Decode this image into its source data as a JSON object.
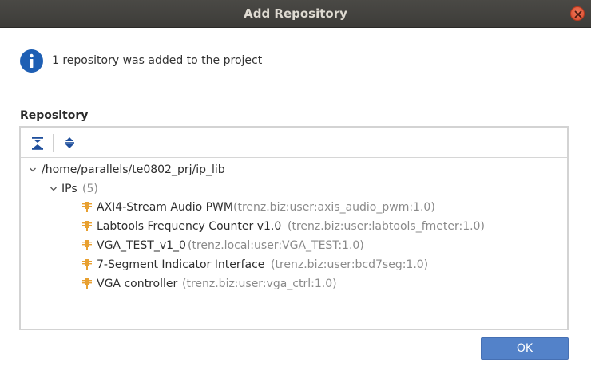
{
  "window": {
    "title": "Add Repository"
  },
  "message": {
    "text": "1 repository was added to the project"
  },
  "repository": {
    "label": "Repository",
    "root_path": "/home/parallels/te0802_prj/ip_lib",
    "ips_label": "IPs",
    "ips_count": "(5)",
    "items": [
      {
        "name": "AXI4-Stream Audio PWM",
        "vlnv": "(trenz.biz:user:axis_audio_pwm:1.0)"
      },
      {
        "name": "Labtools Frequency Counter v1.0",
        "vlnv": "(trenz.biz:user:labtools_fmeter:1.0)"
      },
      {
        "name": "VGA_TEST_v1_0",
        "vlnv": "(trenz.local:user:VGA_TEST:1.0)"
      },
      {
        "name": "7-Segment Indicator Interface",
        "vlnv": "(trenz.biz:user:bcd7seg:1.0)"
      },
      {
        "name": "VGA controller",
        "vlnv": "(trenz.biz:user:vga_ctrl:1.0)"
      }
    ]
  },
  "toolbar": {
    "collapse_all_icon": "collapse-all-icon",
    "expand_all_icon": "expand-all-icon"
  },
  "buttons": {
    "ok_label": "OK"
  },
  "colors": {
    "titlebar": "#3f3e3b",
    "accent": "#5382c9",
    "info": "#1e5fb4",
    "ip_icon": "#e8a030"
  }
}
